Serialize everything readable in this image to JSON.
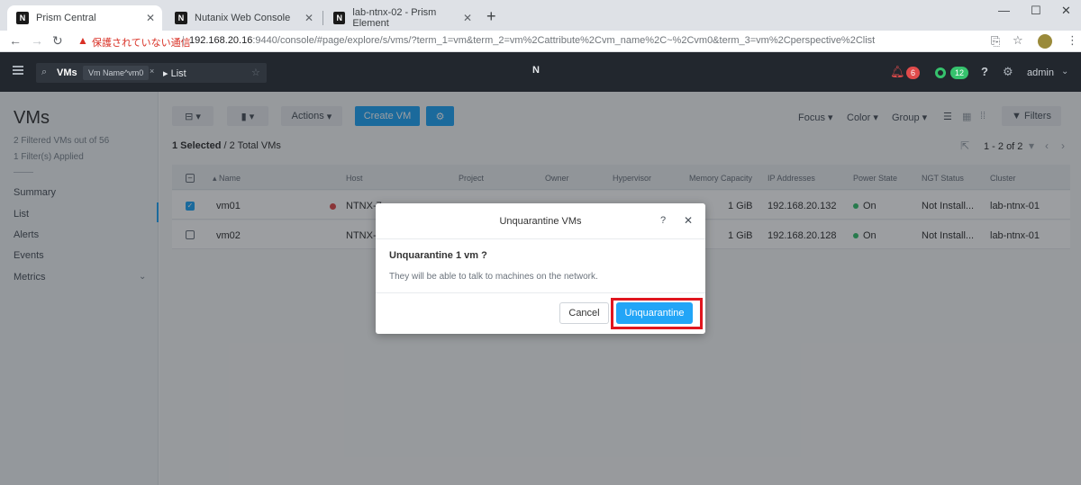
{
  "browser": {
    "tabs": [
      {
        "title": "Prism Central"
      },
      {
        "title": "Nutanix Web Console"
      },
      {
        "title": "lab-ntnx-02 - Prism Element"
      }
    ],
    "new_tab": "+",
    "insecure_label": "保護されていない通信",
    "url_host": "192.168.20.16",
    "url_rest": ":9440/console/#page/explore/s/vms/?term_1=vm&term_2=vm%2Cattribute%2Cvm_name%2C~%2Cvm0&term_3=vm%2Cperspective%2Clist"
  },
  "header": {
    "search_entity": "VMs",
    "search_chip": "Vm Name^vm0",
    "search_chip_close": "×",
    "search_view": "List",
    "alerts_count": "6",
    "tasks_count": "12",
    "help": "?",
    "user": "admin",
    "logo": "N"
  },
  "sidebar": {
    "title": "VMs",
    "filtered": "2 Filtered VMs out of 56",
    "filters_applied": "1 Filter(s) Applied",
    "items": [
      {
        "label": "Summary"
      },
      {
        "label": "List"
      },
      {
        "label": "Alerts"
      },
      {
        "label": "Events"
      },
      {
        "label": "Metrics"
      }
    ]
  },
  "toolbar": {
    "actions": "Actions",
    "create_vm": "Create VM",
    "focus": "Focus",
    "color": "Color",
    "group": "Group",
    "filters": "Filters"
  },
  "list": {
    "selected": "1 Selected",
    "total": "/ 2 Total VMs",
    "pager": "1 - 2 of 2",
    "columns": [
      "Name",
      "Host",
      "Project",
      "Owner",
      "Hypervisor",
      "Memory Capacity",
      "IP Addresses",
      "Power State",
      "NGT Status",
      "Cluster"
    ],
    "rows": [
      {
        "name": "vm01",
        "host": "NTNX-7",
        "memory": "1 GiB",
        "ip": "192.168.20.132",
        "power": "On",
        "ngt": "Not Install...",
        "cluster": "lab-ntnx-01"
      },
      {
        "name": "vm02",
        "host": "NTNX-7",
        "memory": "1 GiB",
        "ip": "192.168.20.128",
        "power": "On",
        "ngt": "Not Install...",
        "cluster": "lab-ntnx-01"
      }
    ]
  },
  "dialog": {
    "title": "Unquarantine VMs",
    "help": "?",
    "question": "Unquarantine 1 vm ?",
    "message": "They will be able to talk to machines on the network.",
    "cancel": "Cancel",
    "confirm": "Unquarantine"
  },
  "colors": {
    "accent": "#22a5f7",
    "header_bg": "#22272e",
    "alert": "#e04b4b",
    "ok": "#36c26d",
    "highlight": "#e0161f"
  }
}
